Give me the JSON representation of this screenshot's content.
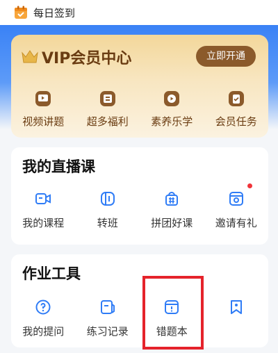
{
  "header": {
    "signin_label": "每日签到"
  },
  "vip": {
    "title": "VIP会员中心",
    "open_button": "立即开通",
    "items": [
      {
        "label": "视频讲题",
        "icon": "video-lesson-icon"
      },
      {
        "label": "超多福利",
        "icon": "benefits-icon"
      },
      {
        "label": "素养乐学",
        "icon": "literacy-icon"
      },
      {
        "label": "会员任务",
        "icon": "member-task-icon"
      }
    ]
  },
  "live": {
    "title": "我的直播课",
    "items": [
      {
        "label": "我的课程",
        "icon": "camera-icon"
      },
      {
        "label": "转班",
        "icon": "transfer-class-icon"
      },
      {
        "label": "拼团好课",
        "icon": "group-buy-icon"
      },
      {
        "label": "邀请有礼",
        "icon": "invite-icon",
        "badge": true
      }
    ]
  },
  "tools": {
    "title": "作业工具",
    "items": [
      {
        "label": "我的提问",
        "icon": "question-icon"
      },
      {
        "label": "练习记录",
        "icon": "practice-record-icon"
      },
      {
        "label": "错题本",
        "icon": "wrong-question-book-icon",
        "highlighted": true
      },
      {
        "label": "",
        "icon": "bookmark-icon"
      }
    ]
  },
  "colors": {
    "accent_blue": "#2f7cf6",
    "vip_brown": "#6a3c12",
    "highlight_red": "#e5232b"
  }
}
